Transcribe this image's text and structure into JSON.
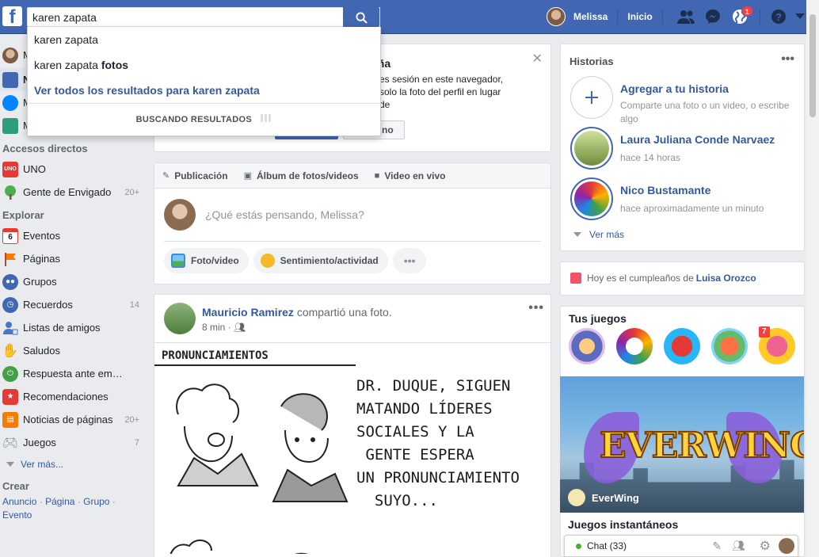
{
  "search": {
    "value": "karen zapata",
    "suggestions": [
      {
        "text": "karen zapata",
        "bold": ""
      },
      {
        "text": "karen zapata ",
        "bold": "fotos"
      }
    ],
    "see_all": "Ver todos los resultados para karen zapata",
    "status": "BUSCANDO RESULTADOS"
  },
  "topbar": {
    "user": "Melissa",
    "home": "Inicio",
    "notif_count": "1"
  },
  "left": {
    "user_items": [
      {
        "label": "M",
        "icon": "avatar"
      },
      {
        "label": "N",
        "icon": "news-feed-icon"
      },
      {
        "label": "M",
        "icon": "messenger-icon"
      },
      {
        "label": "M",
        "icon": "marketplace-icon"
      }
    ],
    "shortcuts_title": "Accesos directos",
    "shortcuts": [
      {
        "label": "UNO",
        "count": "",
        "color": "#e53935"
      },
      {
        "label": "Gente de Envigado",
        "count": "20+",
        "color": "#4caf50"
      }
    ],
    "explore_title": "Explorar",
    "explore": [
      {
        "label": "Eventos",
        "count": "",
        "color": "#e53935"
      },
      {
        "label": "Páginas",
        "count": "",
        "color": "#f57c00"
      },
      {
        "label": "Grupos",
        "count": "",
        "color": "#4267b2"
      },
      {
        "label": "Recuerdos",
        "count": "14",
        "color": "#4267b2"
      },
      {
        "label": "Listas de amigos",
        "count": "",
        "color": "#4267b2"
      },
      {
        "label": "Saludos",
        "count": "",
        "color": "#4267b2"
      },
      {
        "label": "Respuesta ante em…",
        "count": "",
        "color": "#43a047"
      },
      {
        "label": "Recomendaciones",
        "count": "",
        "color": "#e53935"
      },
      {
        "label": "Noticias de páginas",
        "count": "20+",
        "color": "#f57c00"
      },
      {
        "label": "Juegos",
        "count": "7",
        "color": "#78909c"
      }
    ],
    "see_more": "Ver más...",
    "create_title": "Crear",
    "create_links": [
      "Anuncio",
      "Página",
      "Grupo",
      "Evento"
    ]
  },
  "promo": {
    "title": "eña",
    "text": "es sesión en este navegador, solo la foto del perfil en lugar de",
    "btn2": "no"
  },
  "composer": {
    "tabs": [
      "Publicación",
      "Álbum de fotos/videos",
      "Video en vivo"
    ],
    "placeholder": "¿Qué estás pensando, Melissa?",
    "actions": [
      "Foto/video",
      "Sentimiento/actividad"
    ]
  },
  "post": {
    "author": "Mauricio Ramirez",
    "action": " compartió una foto.",
    "time": "8 min",
    "comic_title": "PRONUNCIAMIENTOS",
    "comic_text": "DR. DUQUE, SIGUEN\nMATANDO LÍDERES\nSOCIALES Y LA\n GENTE ESPERA\nUN PRONUNCIAMIENTO\n  SUYO..."
  },
  "stories": {
    "title": "Historias",
    "add_title": "Agregar a tu historia",
    "add_sub": "Comparte una foto o un video, o escribe algo",
    "items": [
      {
        "name": "Laura Juliana Conde Narvaez",
        "time": "hace 14 horas"
      },
      {
        "name": "Nico Bustamante",
        "time": "hace aproximadamente un minuto"
      }
    ],
    "see_more": "Ver más"
  },
  "birthday": {
    "text": "Hoy es el cumpleaños de ",
    "name": "Luisa Orozco"
  },
  "games": {
    "title": "Tus juegos",
    "badge": "7",
    "featured": "EverWing",
    "featured_logo": "EVERWING",
    "instant_title": "Juegos instantáneos"
  },
  "chat": {
    "label": "Chat (33)"
  }
}
